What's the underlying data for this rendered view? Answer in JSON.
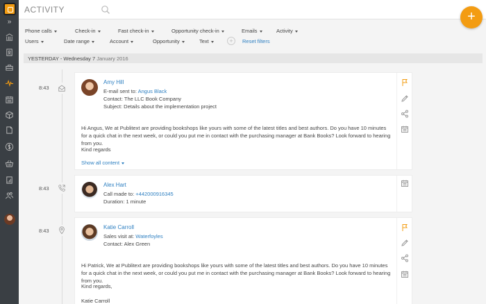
{
  "header": {
    "title": "ACTIVITY",
    "fab_label": "+"
  },
  "sidebar": {
    "collapse_label": "»"
  },
  "filters": {
    "row1": [
      "Phone calls",
      "Check-in",
      "Fast check-in",
      "Opportunity check-in",
      "Emails",
      "Activity"
    ],
    "row2": [
      "Users",
      "Date range",
      "Account",
      "Opportunity",
      "Text"
    ],
    "add_label": "+",
    "reset_label": "Reset filters"
  },
  "day_header": {
    "label": "YESTERDAY - Wednesday 7",
    "date": "January 2016"
  },
  "activities": [
    {
      "time": "8:43",
      "name": "Amy Hill",
      "line1_label": "E-mail sent to:",
      "line1_link": "Angus Black",
      "line2": "Contact: The LLC Book Company",
      "line3": "Subject: Details about the implementation project",
      "body": "Hi Angus, We at Publitext are providing bookshops like yours with some of the latest titles and best authors. Do you have 10 minutes for a quick chat in the next week, or could you put me in contact with the purchasing manager at Bank Books? Look forward to hearing from you.",
      "closing": "Kind regards",
      "show_all": "Show all content"
    },
    {
      "time": "8:43",
      "name": "Alex Hart",
      "line1_label": "Call made to:",
      "line1_link": "+442000916345",
      "line2": "Duration: 1 minute"
    },
    {
      "time": "8:43",
      "name": "Katie Carroll",
      "line1_label": "Sales visit at:",
      "line1_link": "Waterfoyles",
      "line2": "Contact: Alex Green",
      "body": "Hi Patrick, We at Publitext are providing bookshops like yours with some of the latest titles and best authors. Do you have 10 minutes for a quick chat in the next week, or could you put me in contact with the purchasing manager at Bank Books? Look forward to hearing from you.",
      "closing": "Kind regards,",
      "signature": "Katie Carroll"
    }
  ],
  "colors": {
    "accent": "#f39c12",
    "link": "#2d7fc1",
    "sidebar": "#3a3f44"
  },
  "icons": {
    "sidebar": [
      "bank-icon",
      "contacts-icon",
      "briefcase-icon",
      "activity-icon",
      "calendar-icon",
      "box-icon",
      "document-icon",
      "dollar-icon",
      "basket-icon",
      "report-icon",
      "users-icon"
    ],
    "timeline": [
      "email-icon",
      "phone-icon",
      "location-pin-icon"
    ],
    "actions": [
      "flag-icon",
      "edit-icon",
      "share-icon",
      "calendar-add-icon"
    ]
  }
}
